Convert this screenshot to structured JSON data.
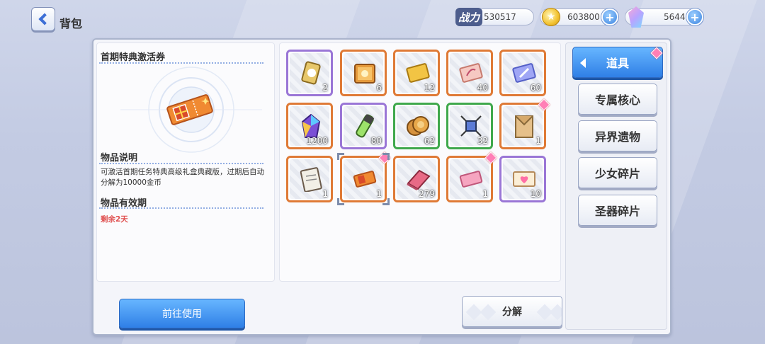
{
  "header": {
    "title": "背包",
    "power_label": "战力",
    "power_value": "530517",
    "coins": "603800",
    "gems": "5644"
  },
  "detail": {
    "item_name": "首期特典激活券",
    "desc_title": "物品说明",
    "desc_text": "可激活首期任务特典高级礼盒典藏版，过期后自动分解为10000金币",
    "validity_title": "物品有效期",
    "validity_text": "剩余2天"
  },
  "grid": {
    "items": [
      {
        "name": "can-item",
        "count": "2",
        "rarity": "purple",
        "icon": "can-icon",
        "badge": false
      },
      {
        "name": "crate-item",
        "count": "6",
        "rarity": "orange",
        "icon": "crate-icon",
        "badge": false
      },
      {
        "name": "gold-card-item",
        "count": "12",
        "rarity": "orange",
        "icon": "card-icon",
        "badge": false
      },
      {
        "name": "dna-card-item",
        "count": "40",
        "rarity": "orange",
        "icon": "dna-card-icon",
        "badge": false
      },
      {
        "name": "sword-card-item",
        "count": "60",
        "rarity": "orange",
        "icon": "sword-card-icon",
        "badge": false
      },
      {
        "name": "crystal-item",
        "count": "1200",
        "rarity": "orange",
        "icon": "crystal-icon",
        "badge": false
      },
      {
        "name": "potion-item",
        "count": "80",
        "rarity": "purple",
        "icon": "potion-icon",
        "badge": false
      },
      {
        "name": "coin-item",
        "count": "62",
        "rarity": "green",
        "icon": "coin-icon",
        "badge": false
      },
      {
        "name": "chip-item",
        "count": "32",
        "rarity": "green",
        "icon": "chip-icon",
        "badge": false
      },
      {
        "name": "envelope-item",
        "count": "1",
        "rarity": "orange",
        "icon": "envelope-icon",
        "badge": true
      },
      {
        "name": "clipboard-item",
        "count": "1",
        "rarity": "orange",
        "icon": "clipboard-icon",
        "badge": false
      },
      {
        "name": "ticket-item",
        "count": "1",
        "rarity": "orange",
        "icon": "ticket-icon",
        "badge": true
      },
      {
        "name": "cloth-item",
        "count": "279",
        "rarity": "orange",
        "icon": "cloth-icon",
        "badge": false
      },
      {
        "name": "pink-ticket-item",
        "count": "1",
        "rarity": "orange",
        "icon": "pink-ticket-icon",
        "badge": true
      },
      {
        "name": "heart-ticket-item",
        "count": "10",
        "rarity": "purple",
        "icon": "heart-ticket-icon",
        "badge": false
      }
    ]
  },
  "categories": [
    {
      "label": "道具",
      "active": true
    },
    {
      "label": "专属核心",
      "active": false
    },
    {
      "label": "异界遗物",
      "active": false
    },
    {
      "label": "少女碎片",
      "active": false
    },
    {
      "label": "圣器碎片",
      "active": false
    }
  ],
  "actions": {
    "use_label": "前往使用",
    "disassemble_label": "分解"
  },
  "colors": {
    "accent_blue": "#2f7fe6",
    "rarity_orange": "#df7a36",
    "rarity_purple": "#9a76d6",
    "rarity_green": "#3fa84c",
    "expire_red": "#e05050"
  }
}
